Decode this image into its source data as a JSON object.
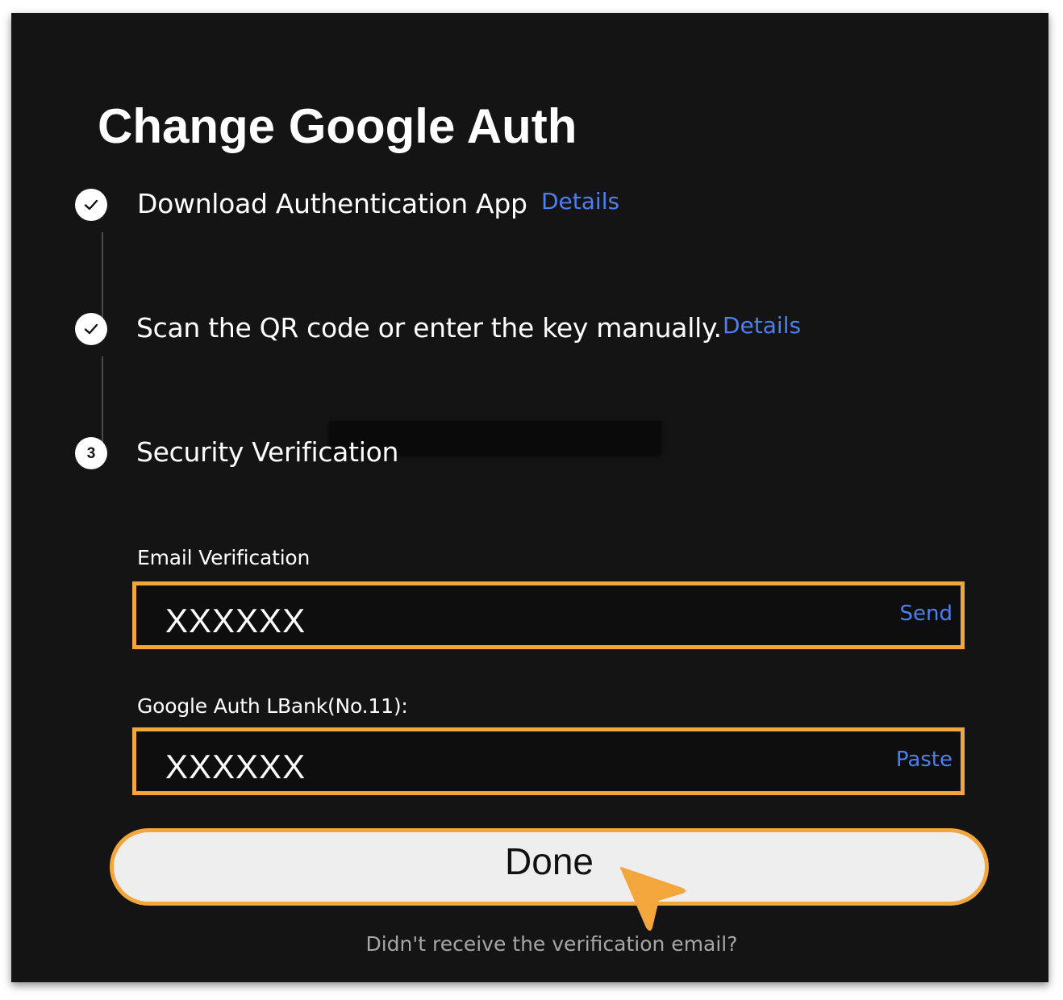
{
  "dialog": {
    "title": "Change Google Auth"
  },
  "steps": [
    {
      "status": "completed",
      "icon": "check-icon",
      "label": "Download Authentication App",
      "link": "Details"
    },
    {
      "status": "completed",
      "icon": "check-icon",
      "label": "Scan the QR code or enter the key manually.",
      "link": "Details"
    },
    {
      "status": "current",
      "number": "3",
      "label": "Security Verification"
    }
  ],
  "email_verification": {
    "label": "Email Verification",
    "value": "XXXXXX",
    "action": "Send"
  },
  "google_auth": {
    "label": "Google Auth LBank(No.11):",
    "value": "XXXXXX",
    "action": "Paste"
  },
  "done_button": {
    "label": "Done"
  },
  "resend_email": {
    "label": "Didn't receive the verification email?"
  },
  "colors": {
    "background": "#141414",
    "accent_highlight": "#f2a63c",
    "link": "#4d7ef2",
    "muted_text": "#a6a6a6"
  }
}
